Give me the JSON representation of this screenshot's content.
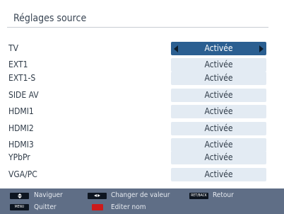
{
  "title": "Réglages source",
  "rows": [
    {
      "label": "TV",
      "value": "Activée",
      "selected": true
    },
    {
      "label": "EXT1",
      "value": "Activée"
    },
    {
      "label": "EXT1-S",
      "value": "Activée"
    },
    {
      "label": "SIDE AV",
      "value": "Activée"
    },
    {
      "label": "HDMI1",
      "value": "Activée"
    },
    {
      "label": "HDMI2",
      "value": "Activée"
    },
    {
      "label": "HDMI3",
      "value": "Activée"
    },
    {
      "label": "YPbPr",
      "value": "Activée"
    },
    {
      "label": "VGA/PC",
      "value": "Activée"
    }
  ],
  "footer": {
    "navigate": "Naviguer",
    "change_value": "Changer de valeur",
    "back": "Retour",
    "back_key": "RET/BACK",
    "quit": "Quitter",
    "quit_key": "MENU",
    "edit_name": "Editer nom"
  },
  "colors": {
    "selected": "#2b5f91",
    "value_bg": "#e3ebf3",
    "footer_bg": "#5f6e86",
    "red_key": "#cc1b1b"
  }
}
